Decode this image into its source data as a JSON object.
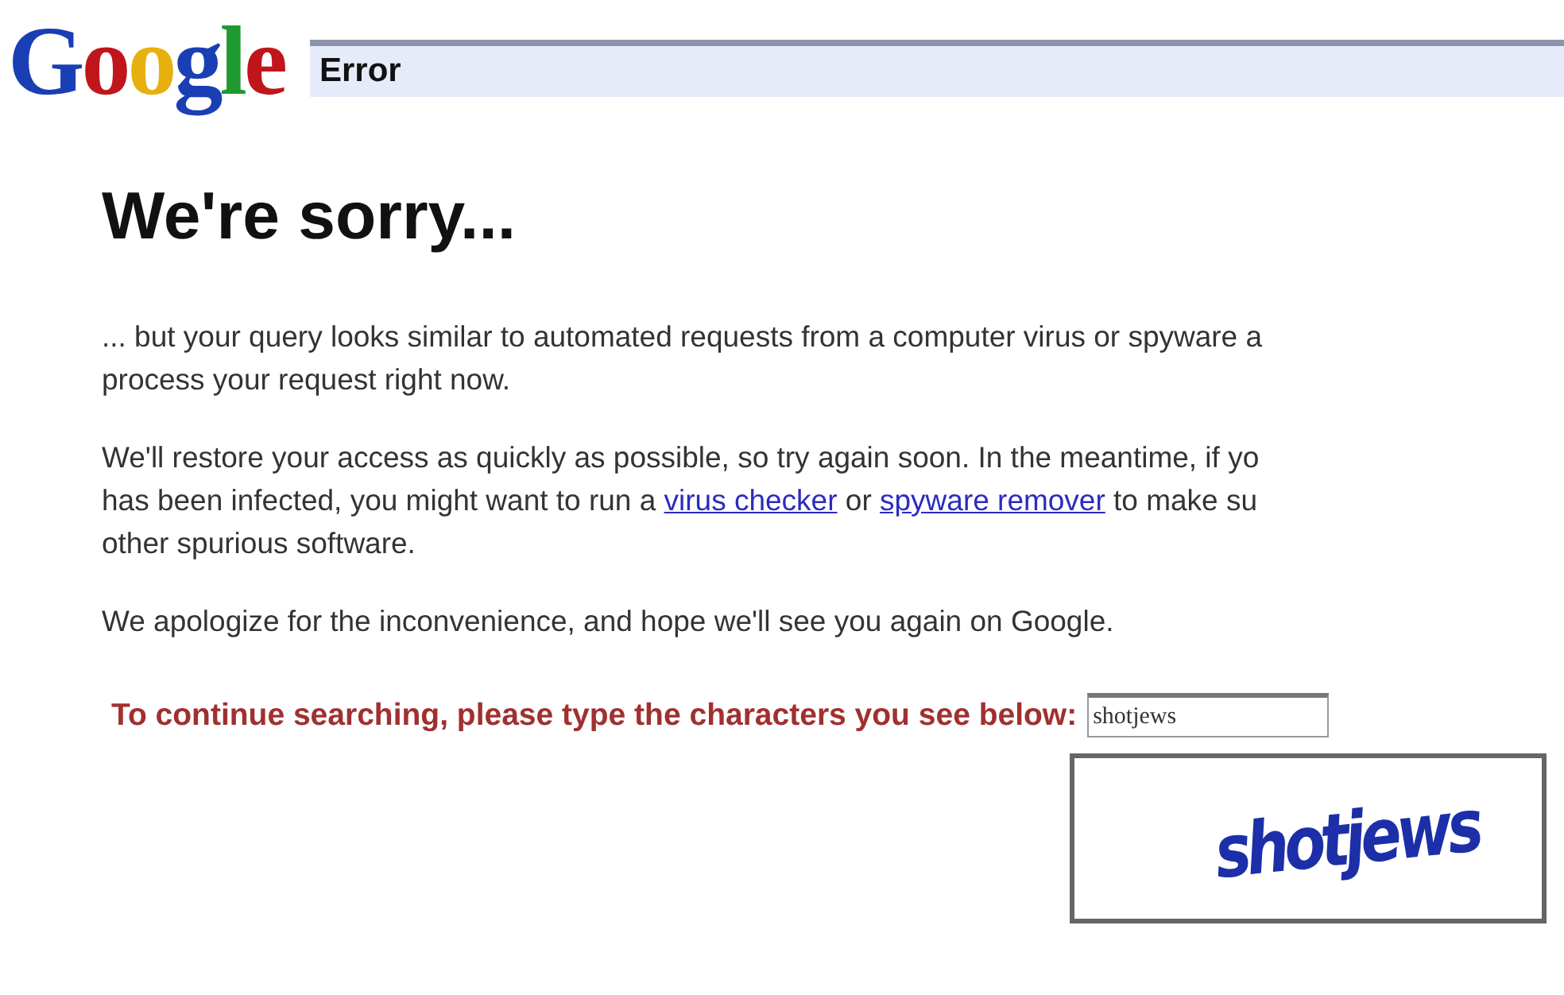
{
  "logo": "Google",
  "title_bar": {
    "title": "Error"
  },
  "heading": "We're sorry...",
  "paragraphs": [
    {
      "lines": [
        [
          {
            "kind": "text",
            "text": "... but your query looks similar to automated requests from a computer virus or spyware a"
          }
        ],
        [
          {
            "kind": "text",
            "text": "process your request right now."
          }
        ]
      ]
    },
    {
      "lines": [
        [
          {
            "kind": "text",
            "text": "We'll restore your access as quickly as possible, so try again soon. In the meantime, if yo"
          }
        ],
        [
          {
            "kind": "text",
            "text": "has been infected, you might want to run a "
          },
          {
            "kind": "link",
            "text": "virus checker"
          },
          {
            "kind": "text",
            "text": " or "
          },
          {
            "kind": "link",
            "text": "spyware remover"
          },
          {
            "kind": "text",
            "text": " to make su"
          }
        ],
        [
          {
            "kind": "text",
            "text": "other spurious software."
          }
        ]
      ]
    },
    {
      "lines": [
        [
          {
            "kind": "text",
            "text": "We apologize for the inconvenience, and hope we'll see you again on Google."
          }
        ]
      ]
    }
  ],
  "captcha": {
    "prompt": "To continue searching, please type the characters you see below:",
    "value": "shotjews",
    "image_text": "shotjews"
  }
}
